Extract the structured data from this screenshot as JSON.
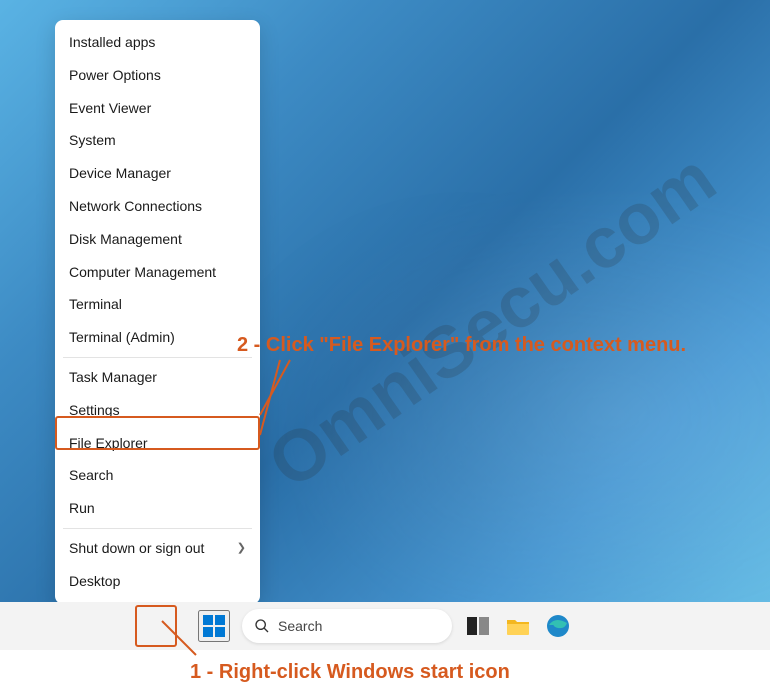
{
  "watermark": "OmniSecu.com",
  "menu": {
    "items": [
      "Installed apps",
      "Power Options",
      "Event Viewer",
      "System",
      "Device Manager",
      "Network Connections",
      "Disk Management",
      "Computer Management",
      "Terminal",
      "Terminal (Admin)",
      "Task Manager",
      "Settings",
      "File Explorer",
      "Search",
      "Run",
      "Shut down or sign out",
      "Desktop"
    ],
    "divider_after": [
      9,
      14
    ],
    "submenu_at": 15
  },
  "taskbar": {
    "search_placeholder": "Search"
  },
  "annotations": {
    "step1": "1 - Right-click Windows start icon",
    "step2": "2 - Click \"File Explorer\" from the context menu."
  },
  "colors": {
    "accent": "#d65a1f",
    "win_blue": "#0078d4"
  }
}
